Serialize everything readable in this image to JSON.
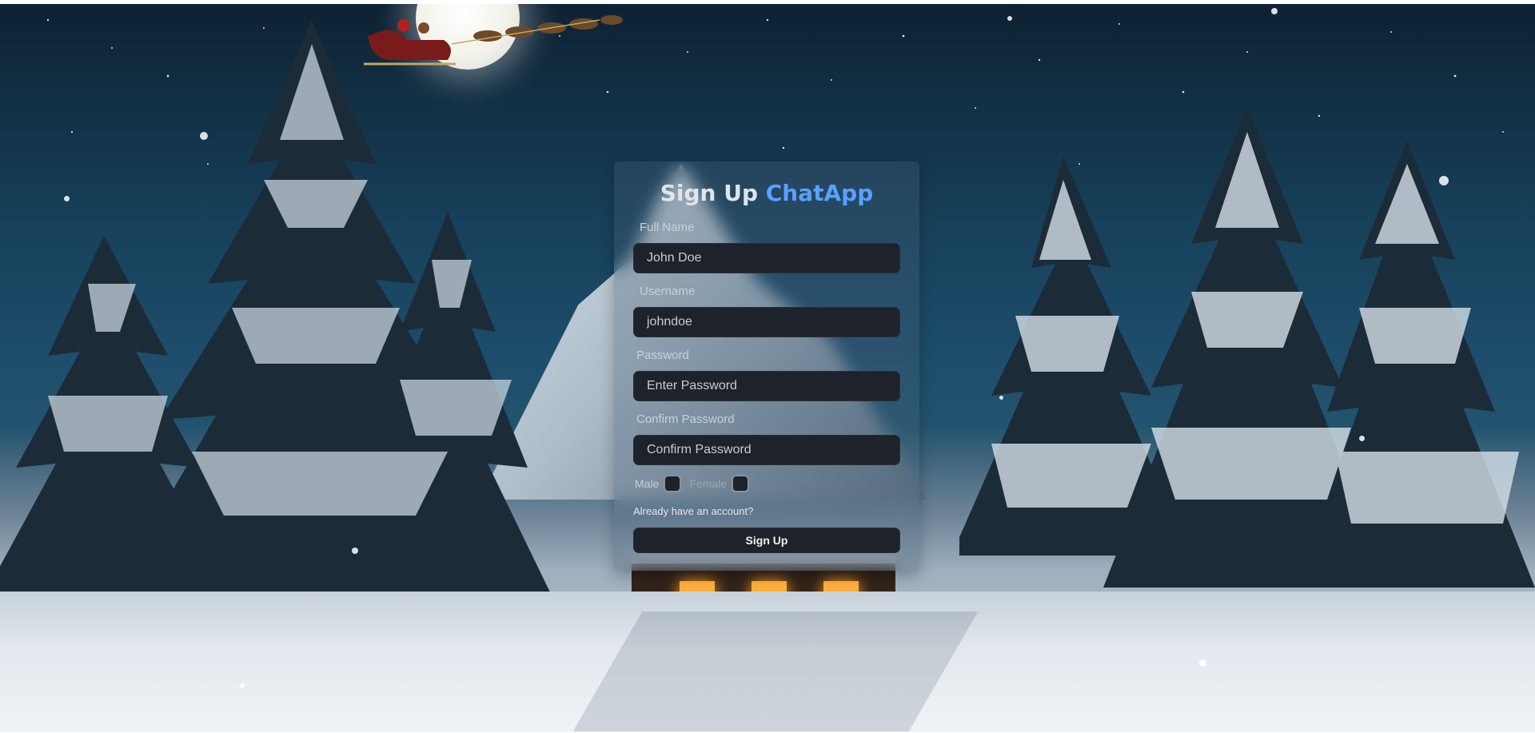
{
  "background": {
    "scene": "snowy-christmas-night",
    "colors": {
      "sky_top": "#0d2233",
      "sky_mid": "#1d4d6b",
      "snow": "#e4e9ef"
    }
  },
  "signup": {
    "title_prefix": "Sign Up",
    "title_brand": "ChatApp",
    "brand_color": "#5aa0ff",
    "full_name": {
      "label": "Full Name",
      "placeholder": "John Doe"
    },
    "username": {
      "label": "Username",
      "placeholder": "johndoe"
    },
    "password": {
      "label": "Password",
      "placeholder": "Enter Password"
    },
    "confirm_password": {
      "label": "Confirm Password",
      "placeholder": "Confirm Password"
    },
    "gender": {
      "male_label": "Male",
      "female_label": "Female",
      "male_checked": false,
      "female_checked": false
    },
    "login_link": "Already have an account?",
    "submit_label": "Sign Up"
  }
}
